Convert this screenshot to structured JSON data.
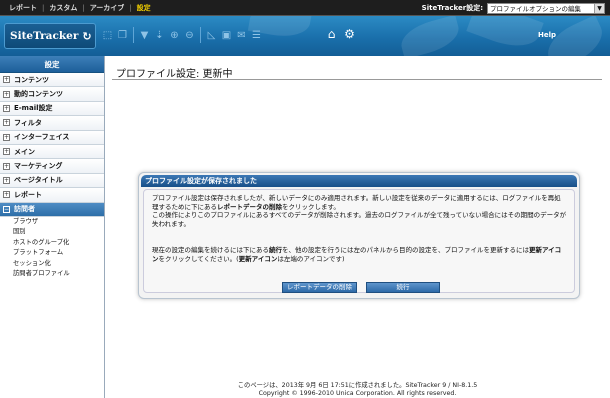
{
  "topnav": {
    "items": [
      "レポート",
      "カスタム",
      "アーカイブ",
      "設定"
    ],
    "separator": "|",
    "active_index": 3,
    "active_color": "#f3d000"
  },
  "settings": {
    "label": "SiteTracker設定:",
    "selected": "プロファイルオプションの編集"
  },
  "header": {
    "logo": "SiteTracker",
    "help": "Help",
    "tool_icons": [
      "refresh-icon",
      "select-icon",
      "copy-icon",
      "filter-icon",
      "filter-down-icon",
      "zoom-in-icon",
      "zoom-out-icon",
      "chart-icon",
      "save-icon",
      "email-icon",
      "list-icon",
      "home-icon",
      "gear-icon"
    ]
  },
  "sidebar": {
    "title": "設定",
    "items": [
      "コンテンツ",
      "動的コンテンツ",
      "E-mail設定",
      "フィルタ",
      "インターフェイス",
      "メイン",
      "マーケティング",
      "ページタイトル",
      "レポート",
      "訪問者"
    ],
    "active_index": 9,
    "subitems": [
      "ブラウザ",
      "国別",
      "ホストのグループ化",
      "プラットフォーム",
      "セッション化",
      "訪問者プロファイル"
    ]
  },
  "main": {
    "title": "プロファイル設定: 更新中"
  },
  "dialog": {
    "title": "プロファイル設定が保存されました",
    "p1_a": "プロファイル設定は保存されましたが、新しいデータにのみ適用されます。新しい設定を従来のデータに適用するには、ログファイルを再処",
    "p1_b_pre": "理するために下にある",
    "p1_b_bold": "レポートデータの削除",
    "p1_b_post": "をクリックします。",
    "p1_c": "この操作によりこのプロファイルにあるすべてのデータが削除されます。過去のログファイルが全て残っていない場合にはその期間のデータが",
    "p1_d": "失われます。",
    "p2_a_pre": "現在の設定の編集を続けるには下にある",
    "p2_a_bold": "続行",
    "p2_a_mid": "を、他の設定を行うには左のパネルから目的の設定を、プロファイルを更新するには",
    "p2_a_bold2": "更新アイコ",
    "p2_b_bold": "ン",
    "p2_b_mid": "をクリックしてください。(",
    "p2_b_bold2": "更新アイコン",
    "p2_b_post": "は左端のアイコンです)",
    "btn_delete": "レポートデータの削除",
    "btn_continue": "続行"
  },
  "footer": {
    "line1": "このページは、2013年 9月 6日 17:51に作成されました。SiteTracker 9 / NI-8.1.5",
    "line2": "Copyright © 1996-2010 Unica Corporation. All rights reserved."
  }
}
